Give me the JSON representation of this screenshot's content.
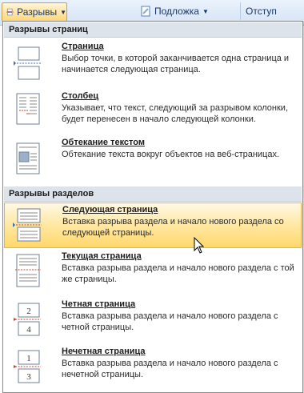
{
  "ribbon": {
    "breaks_label": "Разрывы",
    "watermark_label": "Подложка",
    "indent_label": "Отступ"
  },
  "menu": {
    "page_breaks_header": "Разрывы страниц",
    "section_breaks_header": "Разрывы разделов",
    "items": [
      {
        "title": "Страница",
        "desc": "Выбор точки, в которой заканчивается одна страница и начинается следующая страница."
      },
      {
        "title": "Столбец",
        "desc": "Указывает, что текст, следующий за разрывом колонки, будет перенесен в начало следующей колонки."
      },
      {
        "title": "Обтекание текстом",
        "desc": "Обтекание текста вокруг объектов на веб-страницах."
      },
      {
        "title": "Следующая страница",
        "desc": "Вставка разрыва раздела и начало нового раздела со следующей страницы."
      },
      {
        "title": "Текущая страница",
        "desc": "Вставка разрыва раздела и начало нового раздела с той же страницы."
      },
      {
        "title": "Четная страница",
        "desc": "Вставка разрыва раздела и начало нового раздела с четной страницы."
      },
      {
        "title": "Нечетная страница",
        "desc": "Вставка разрыва раздела и начало нового раздела с нечетной страницы."
      }
    ],
    "even_icon_digits": [
      "2",
      "4"
    ],
    "odd_icon_digits": [
      "1",
      "3"
    ]
  },
  "colors": {
    "highlight": "#ffd86a",
    "section_header_bg": "#dde3ea",
    "break_line": "#c8442b"
  }
}
